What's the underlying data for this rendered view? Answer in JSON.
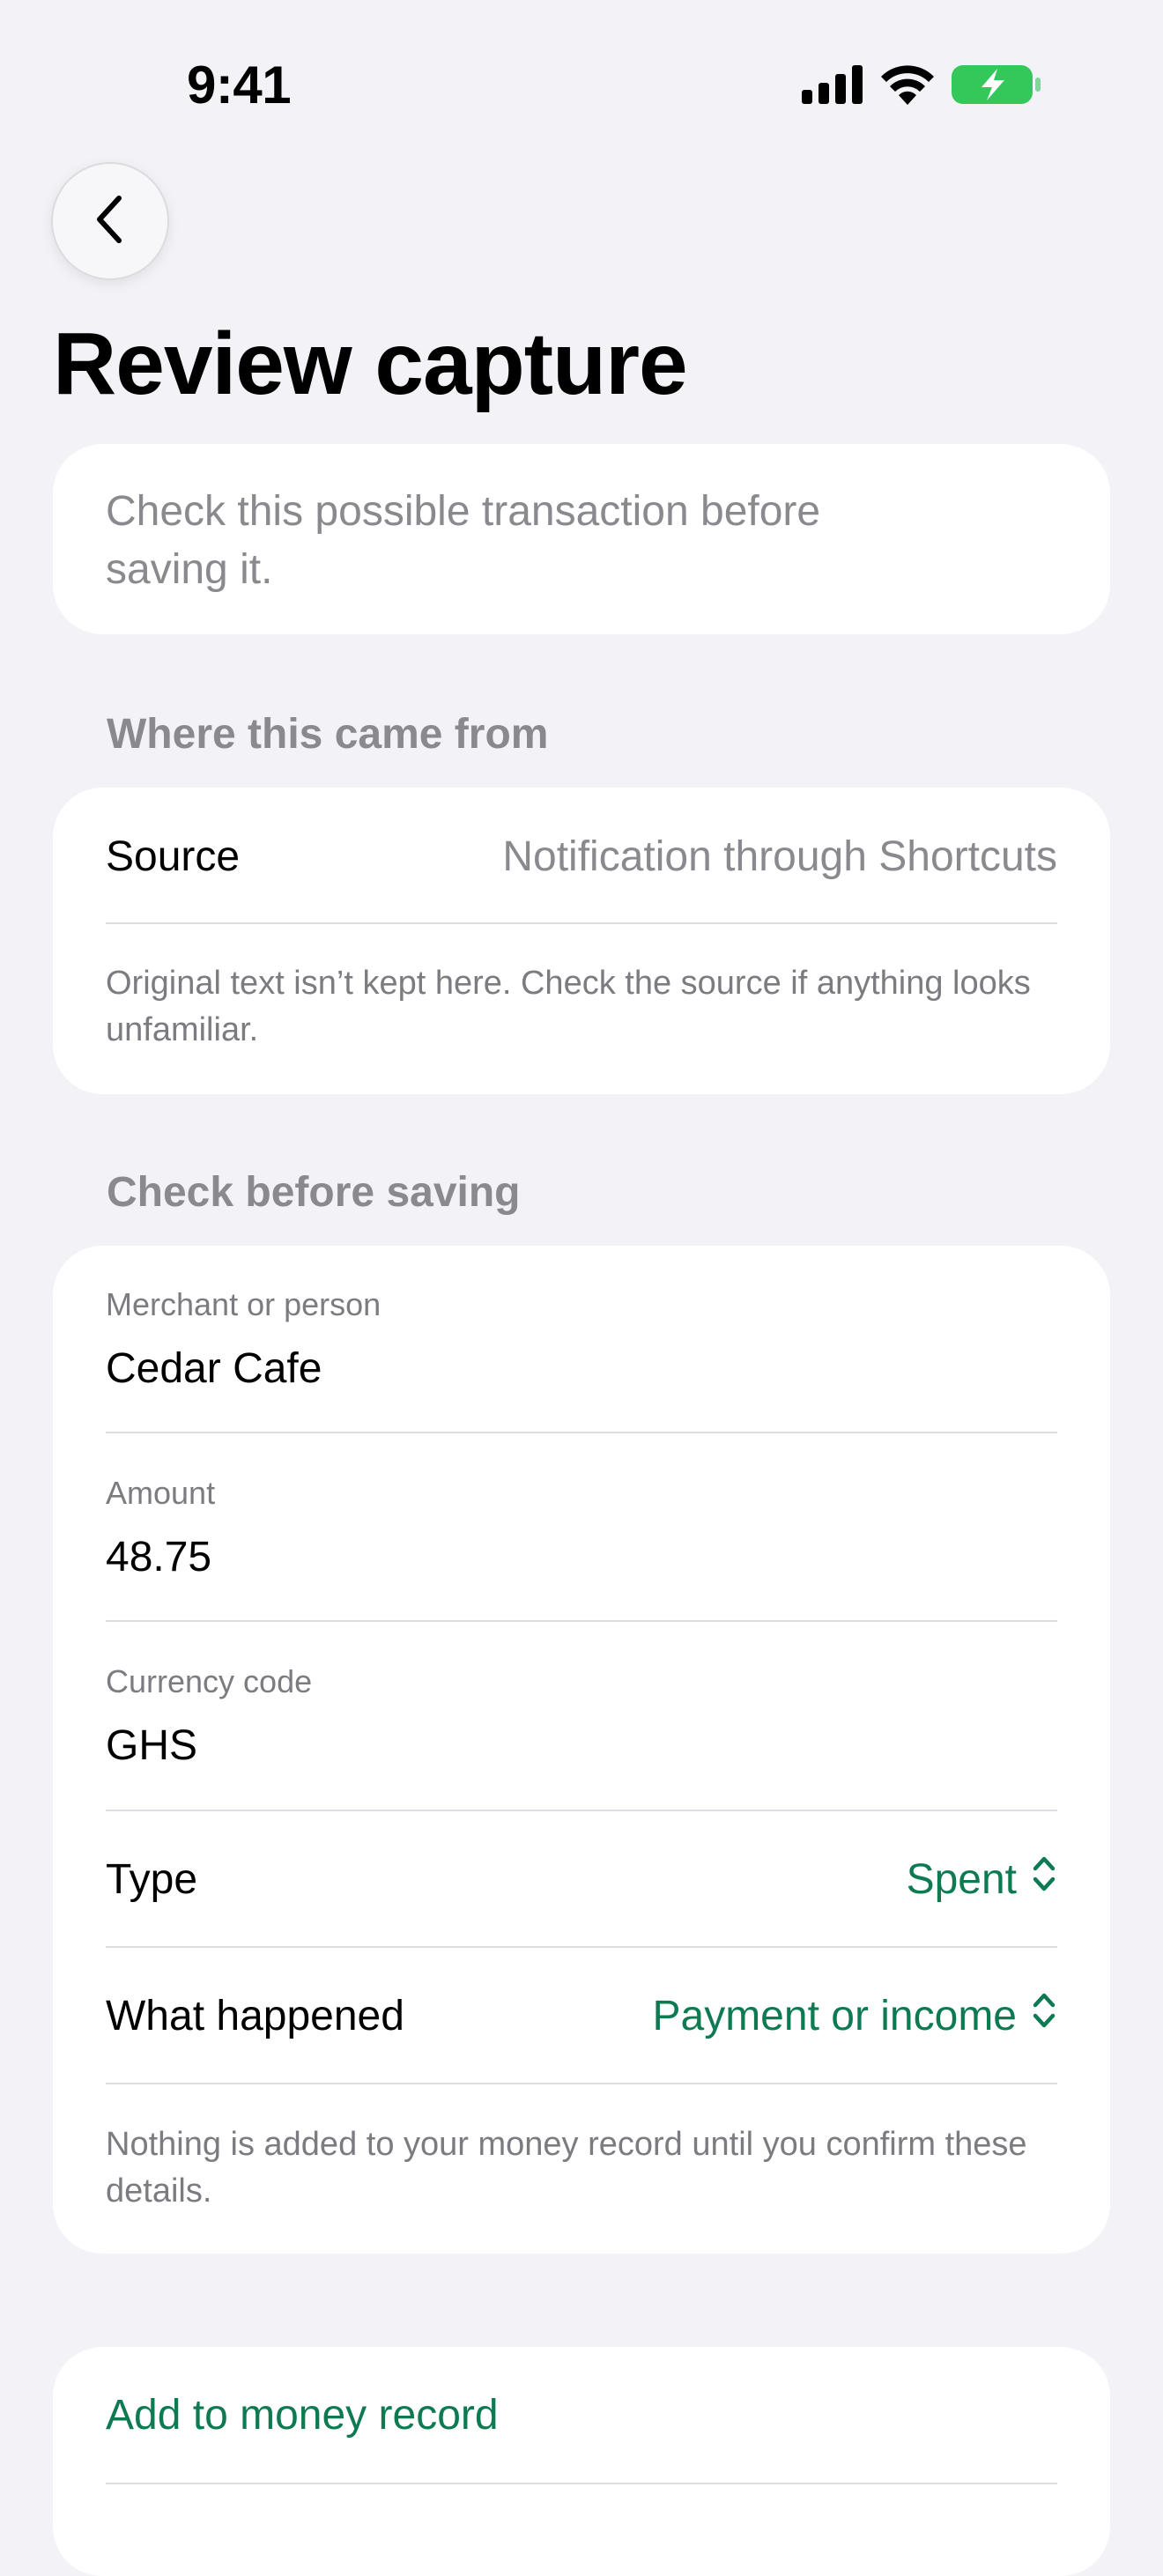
{
  "status_bar": {
    "time": "9:41",
    "icons": [
      "cellular-signal-icon",
      "wifi-icon",
      "battery-charging-icon"
    ],
    "battery_color": "#34c759"
  },
  "nav": {
    "back_icon": "chevron-left-icon"
  },
  "page_title": "Review capture",
  "intro_text": "Check this possible transaction before saving it.",
  "source_section": {
    "header": "Where this came from",
    "source_label": "Source",
    "source_value": "Notification through Shortcuts",
    "note": "Original text isn’t kept here. Check the source if anything looks unfamiliar."
  },
  "details_section": {
    "header": "Check before saving",
    "merchant_label": "Merchant or person",
    "merchant_value": "Cedar Cafe",
    "amount_label": "Amount",
    "amount_value": "48.75",
    "currency_label": "Currency code",
    "currency_value": "GHS",
    "type_label": "Type",
    "type_value": "Spent",
    "happened_label": "What happened",
    "happened_value": "Payment or income",
    "note": "Nothing is added to your money record until you confirm these details."
  },
  "actions": {
    "add_label": "Add to money record"
  },
  "accent_color": "#0e7a52"
}
